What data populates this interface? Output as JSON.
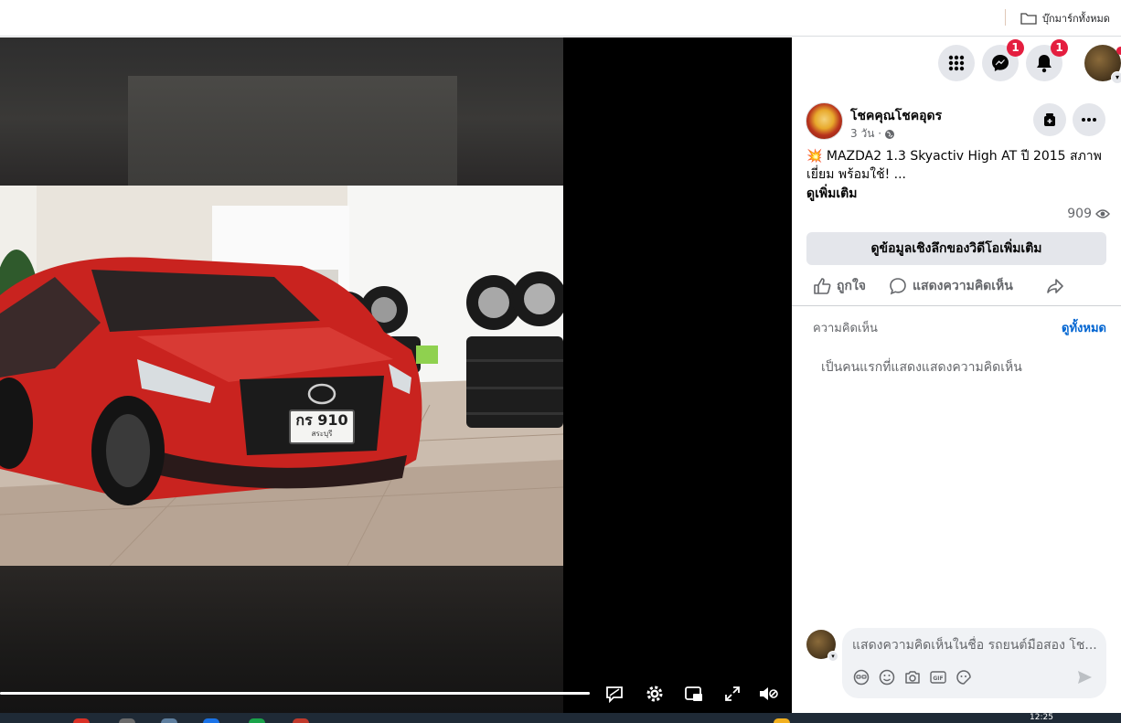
{
  "bookmarks": {
    "all_bookmarks_label": "บุ๊กมาร์กทั้งหมด"
  },
  "video": {
    "progress_fraction": 1.0,
    "plate_main": "กร 910",
    "plate_province": "สระบุรี"
  },
  "topnav": {
    "messenger_badge": "1",
    "notifications_badge": "1"
  },
  "post": {
    "page_name": "โชคคุณโชคอุดร",
    "time": "3 วัน ·",
    "text_line1": "💥 MAZDA2 1.3 Skyactiv High AT ปี 2015 สภาพ",
    "text_line2": "เยี่ยม พร้อมใช้! ...",
    "see_more": "ดูเพิ่มเติม",
    "views": "909",
    "insights_button": "ดูข้อมูลเชิงลึกของวิดีโอเพิ่มเติม"
  },
  "actions": {
    "like": "ถูกใจ",
    "comment": "แสดงความคิดเห็น"
  },
  "comments": {
    "label": "ความคิดเห็น",
    "see_all": "ดูทั้งหมด",
    "first_prompt": "เป็นคนแรกที่แสดงแสดงความคิดเห็น",
    "placeholder": "แสดงความคิดเห็นในชื่อ รถยนต์มือสอง โช..."
  },
  "taskbar": {
    "clock": "12:25"
  },
  "colors": {
    "badge": "#e41e3f",
    "link": "#0064d1",
    "button_gray": "#e4e6eb",
    "secondary_text": "#65676b"
  }
}
